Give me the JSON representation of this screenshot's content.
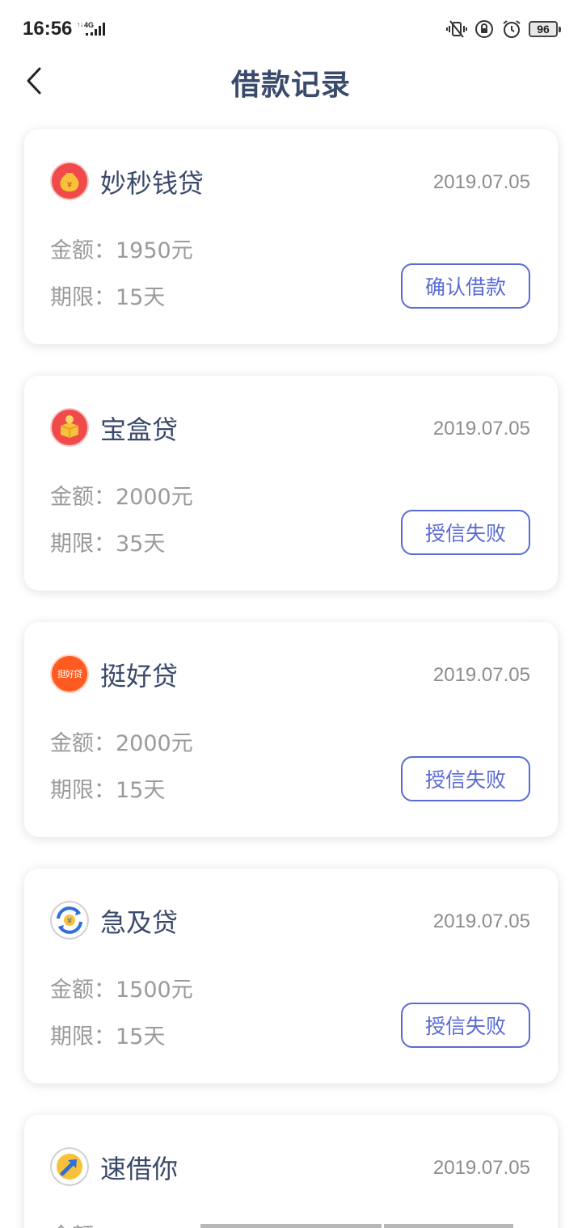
{
  "status_bar": {
    "time": "16:56",
    "network": "4G",
    "battery": "96",
    "icons": [
      "vibrate-off-icon",
      "rotation-lock-icon",
      "alarm-icon"
    ]
  },
  "header": {
    "title": "借款记录",
    "back_icon": "chevron-left-icon"
  },
  "labels": {
    "amount": "金额：",
    "term": "期限："
  },
  "records": [
    {
      "lender": "妙秒钱贷",
      "date": "2019.07.05",
      "amount": "1950元",
      "term": "15天",
      "action": "确认借款",
      "logo_icon": "money-bag-icon",
      "logo_color": "#f04a4a"
    },
    {
      "lender": "宝盒贷",
      "date": "2019.07.05",
      "amount": "2000元",
      "term": "35天",
      "action": "授信失败",
      "logo_icon": "treasure-box-icon",
      "logo_color": "#f04a4a"
    },
    {
      "lender": "挺好贷",
      "date": "2019.07.05",
      "amount": "2000元",
      "term": "15天",
      "action": "授信失败",
      "logo_icon": "tinghaodai-logo-icon",
      "logo_color": "#ff5a1f",
      "logo_text": "挺好贷"
    },
    {
      "lender": "急及贷",
      "date": "2019.07.05",
      "amount": "1500元",
      "term": "15天",
      "action": "授信失败",
      "logo_icon": "yuan-cycle-icon",
      "logo_color": "#2f6fd8"
    },
    {
      "lender": "速借你",
      "date": "2019.07.05",
      "amount": "",
      "term": "",
      "action": "",
      "logo_icon": "arrow-up-right-icon",
      "logo_color": "#2f6fd8"
    }
  ],
  "colors": {
    "accent": "#5b6bd4",
    "title": "#3a4a6b",
    "muted": "#9a9a9a"
  }
}
